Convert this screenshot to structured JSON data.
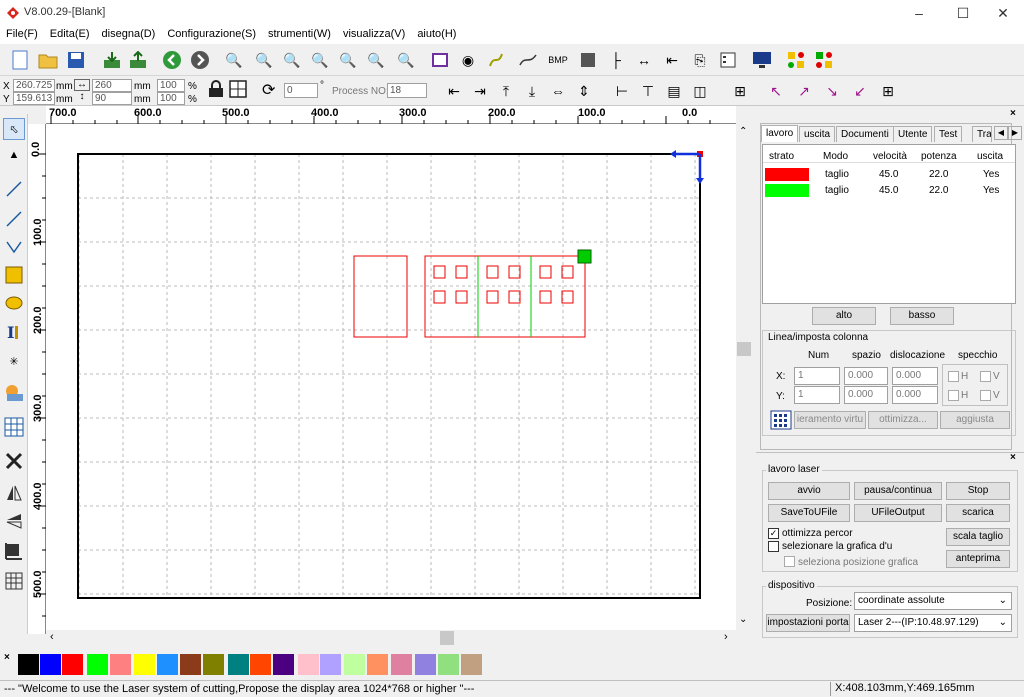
{
  "window": {
    "title": "V8.00.29-[Blank]"
  },
  "menu": [
    "File(F)",
    "Edita(E)",
    "disegna(D)",
    "Configurazione(S)",
    "strumenti(W)",
    "visualizza(V)",
    "aiuto(H)"
  ],
  "coords": {
    "x_label": "X",
    "x_value": "260.725",
    "x_unit": "mm",
    "y_label": "Y",
    "y_value": "159.613",
    "y_unit": "mm",
    "w_value": "260",
    "w_unit": "mm",
    "h_value": "90",
    "h_unit": "mm",
    "sx_value": "100",
    "sx_unit": "%",
    "sy_value": "100",
    "sy_unit": "%",
    "angle_value": "0",
    "angle_unit": "°",
    "process_label": "Process NO:",
    "process_value": "18"
  },
  "ruler": {
    "h_labels": [
      "700.0",
      "600.0",
      "500.0",
      "400.0",
      "300.0",
      "200.0",
      "100.0",
      "0.0"
    ],
    "v_labels": [
      "0.0",
      "100.0",
      "200.0",
      "300.0",
      "400.0",
      "500.0"
    ]
  },
  "tabs": [
    "lavoro",
    "uscita",
    "Documenti",
    "Utente",
    "Test",
    "Tra"
  ],
  "layer_table": {
    "headers": [
      "strato",
      "Modo",
      "velocità",
      "potenza",
      "uscita"
    ],
    "rows": [
      {
        "color": "#ff0000",
        "mode": "taglio",
        "speed": "45.0",
        "power": "22.0",
        "output": "Yes"
      },
      {
        "color": "#00ff00",
        "mode": "taglio",
        "speed": "45.0",
        "power": "22.0",
        "output": "Yes"
      }
    ]
  },
  "layer_buttons": {
    "up": "alto",
    "down": "basso"
  },
  "array": {
    "group_title": "Linea/imposta colonna",
    "col_num": "Num",
    "col_space": "spazio",
    "col_disp": "dislocazione",
    "col_mirror": "specchio",
    "x_label": "X:",
    "y_label": "Y:",
    "x_num": "1",
    "x_space": "0.000",
    "x_disp": "0.000",
    "y_num": "1",
    "y_space": "0.000",
    "y_disp": "0.000",
    "h_label": "H",
    "v_label": "V",
    "btn_virtual": "ieramento virtu",
    "btn_optimize": "ottimizza...",
    "btn_adjust": "aggiusta"
  },
  "laser_work": {
    "group_title": "lavoro laser",
    "start": "avvio",
    "pause": "pausa/continua",
    "stop": "Stop",
    "save_file": "SaveToUFile",
    "ufile_output": "UFileOutput",
    "download": "scarica",
    "opt_path": "ottimizza percor",
    "select_graphic": "selezionare la grafica d'u",
    "select_pos": "seleziona posizione grafica",
    "cut_scale": "scala taglio",
    "preview": "anteprima"
  },
  "device": {
    "group_title": "dispositivo",
    "position_label": "Posizione:",
    "position_value": "coordinate assolute",
    "port_button": "impostazioni porta",
    "laser_value": "Laser 2---(IP:10.48.97.129)"
  },
  "palette": [
    "#000000",
    "#0000ff",
    "#ff0000",
    "#00ff00",
    "#ff8080",
    "#ffff00",
    "#1e90ff",
    "#8b3a1a",
    "#808000",
    "#008080",
    "#ff4500",
    "#4b0082",
    "#ffc0cb",
    "#b0a0ff",
    "#c0ffa0",
    "#ff9060",
    "#e080a0",
    "#9080e0",
    "#90e080",
    "#c0a080"
  ],
  "status": {
    "message": "--- \"Welcome to use the Laser system of cutting,Propose the display area 1024*768 or higher \"---",
    "position": "X:408.103mm,Y:469.165mm"
  }
}
